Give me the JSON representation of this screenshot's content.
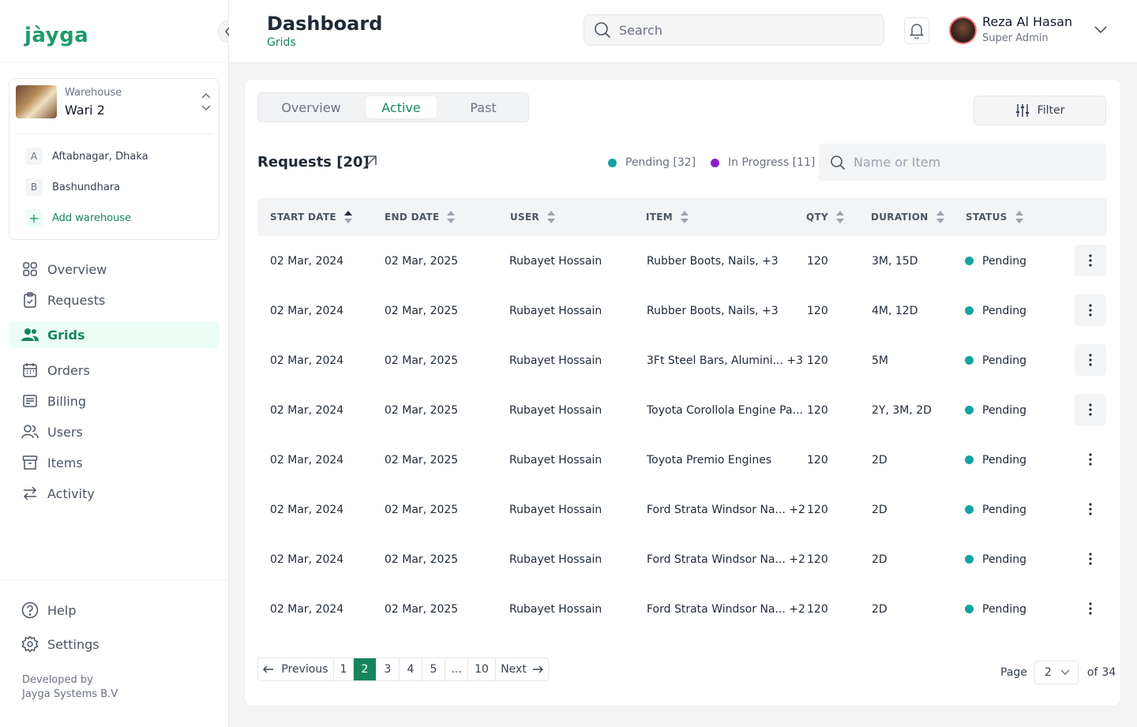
{
  "app": {
    "logo": "jàyga"
  },
  "warehouse": {
    "label": "Warehouse",
    "current": "Wari 2",
    "others": [
      {
        "badge": "A",
        "name": "Aftabnagar, Dhaka"
      },
      {
        "badge": "B",
        "name": "Bashundhara"
      }
    ],
    "add_label": "Add warehouse"
  },
  "nav": {
    "overview": "Overview",
    "requests": "Requests",
    "grids": "Grids",
    "orders": "Orders",
    "billing": "Billing",
    "users": "Users",
    "items": "Items",
    "activity": "Activity",
    "help": "Help",
    "settings": "Settings"
  },
  "footer": {
    "line1": "Developed by",
    "line2": "Jayga Systems B.V"
  },
  "header": {
    "title": "Dashboard",
    "subtitle": "Grids",
    "search_placeholder": "Search",
    "user_name": "Reza Al Hasan",
    "user_role": "Super Admin"
  },
  "tabs": {
    "overview": "Overview",
    "active": "Active",
    "past": "Past"
  },
  "filter_label": "Filter",
  "requests": {
    "title": "Requests [20]",
    "legend_pending": "Pending [32]",
    "legend_progress": "In Progress [11]",
    "search_placeholder": "Name or Item"
  },
  "colors": {
    "accent": "#16855d",
    "pending": "#14a3a3",
    "in_progress": "#8b1fc9"
  },
  "table": {
    "headers": {
      "start": "START DATE",
      "end": "END DATE",
      "user": "USER",
      "item": "ITEM",
      "qty": "QTY",
      "duration": "DURATION",
      "status": "STATUS"
    },
    "rows": [
      {
        "start": "02 Mar, 2024",
        "end": "02 Mar, 2025",
        "user": "Rubayet Hossain",
        "item": "Rubber Boots, Nails, +3",
        "qty": "120",
        "duration": "3M, 15D",
        "status": "Pending"
      },
      {
        "start": "02 Mar, 2024",
        "end": "02 Mar, 2025",
        "user": "Rubayet Hossain",
        "item": "Rubber Boots, Nails, +3",
        "qty": "120",
        "duration": "4M, 12D",
        "status": "Pending"
      },
      {
        "start": "02 Mar, 2024",
        "end": "02 Mar, 2025",
        "user": "Rubayet Hossain",
        "item": "3Ft Steel Bars, Alumini... +3",
        "qty": "120",
        "duration": "5M",
        "status": "Pending"
      },
      {
        "start": "02 Mar, 2024",
        "end": "02 Mar, 2025",
        "user": "Rubayet Hossain",
        "item": "Toyota Corollola Engine Pa...",
        "qty": "120",
        "duration": "2Y, 3M, 2D",
        "status": "Pending"
      },
      {
        "start": "02 Mar, 2024",
        "end": "02 Mar, 2025",
        "user": "Rubayet Hossain",
        "item": "Toyota Premio Engines",
        "qty": "120",
        "duration": "2D",
        "status": "Pending"
      },
      {
        "start": "02 Mar, 2024",
        "end": "02 Mar, 2025",
        "user": "Rubayet Hossain",
        "item": "Ford Strata Windsor Na... +2",
        "qty": "120",
        "duration": "2D",
        "status": "Pending"
      },
      {
        "start": "02 Mar, 2024",
        "end": "02 Mar, 2025",
        "user": "Rubayet Hossain",
        "item": "Ford Strata Windsor Na... +2",
        "qty": "120",
        "duration": "2D",
        "status": "Pending"
      },
      {
        "start": "02 Mar, 2024",
        "end": "02 Mar, 2025",
        "user": "Rubayet Hossain",
        "item": "Ford Strata Windsor Na... +2",
        "qty": "120",
        "duration": "2D",
        "status": "Pending"
      }
    ]
  },
  "pagination": {
    "previous": "Previous",
    "next": "Next",
    "pages": [
      "1",
      "2",
      "3",
      "4",
      "5",
      "...",
      "10"
    ],
    "current": "2",
    "page_label": "Page",
    "page_value": "2",
    "of_label": "of",
    "total": "34"
  }
}
